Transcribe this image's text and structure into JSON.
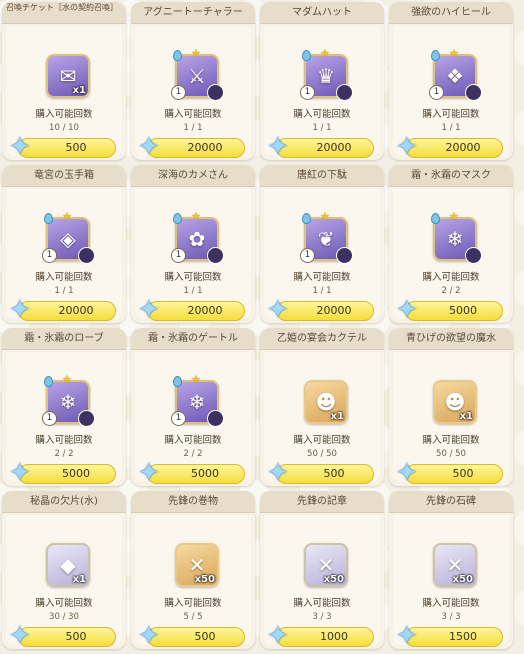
{
  "shop": {
    "items": [
      {
        "title": "召喚チケット［水の契約召喚］",
        "glyph": "✉",
        "count": "x1",
        "level": "",
        "bought": "10 / 10",
        "price": "500",
        "style": "ticket"
      },
      {
        "title": "アグニートーチャラー",
        "glyph": "⚔",
        "count": "",
        "level": "1",
        "bought": "1 / 1",
        "price": "20000",
        "style": "equip"
      },
      {
        "title": "マダムハット",
        "glyph": "♛",
        "count": "",
        "level": "1",
        "bought": "1 / 1",
        "price": "20000",
        "style": "equip"
      },
      {
        "title": "強欲のハイヒール",
        "glyph": "❖",
        "count": "",
        "level": "1",
        "bought": "1 / 1",
        "price": "20000",
        "style": "equip"
      },
      {
        "title": "竜宮の玉手箱",
        "glyph": "◈",
        "count": "",
        "level": "1",
        "bought": "1 / 1",
        "price": "20000",
        "style": "equip"
      },
      {
        "title": "深海のカメさん",
        "glyph": "✿",
        "count": "",
        "level": "1",
        "bought": "1 / 1",
        "price": "20000",
        "style": "equip"
      },
      {
        "title": "唐紅の下駄",
        "glyph": "❦",
        "count": "",
        "level": "1",
        "bought": "1 / 1",
        "price": "20000",
        "style": "equip"
      },
      {
        "title": "霜・氷霜のマスク",
        "glyph": "❄",
        "count": "",
        "level": "",
        "bought": "2 / 2",
        "price": "5000",
        "style": "equip"
      },
      {
        "title": "霜・氷霜のローブ",
        "glyph": "❄",
        "count": "",
        "level": "1",
        "bought": "2 / 2",
        "price": "5000",
        "style": "equip"
      },
      {
        "title": "霜・氷霜のゲートル",
        "glyph": "❄",
        "count": "",
        "level": "1",
        "bought": "2 / 2",
        "price": "5000",
        "style": "equip"
      },
      {
        "title": "乙姫の宴会カクテル",
        "glyph": "☻",
        "count": "x1",
        "level": "",
        "bought": "50 / 50",
        "price": "500",
        "style": "gold"
      },
      {
        "title": "青ひげの欲望の魔水",
        "glyph": "☻",
        "count": "x1",
        "level": "",
        "bought": "50 / 50",
        "price": "500",
        "style": "gold"
      },
      {
        "title": "秘晶の欠片(水)",
        "glyph": "◆",
        "count": "x1",
        "level": "",
        "bought": "30 / 30",
        "price": "500",
        "style": "pale"
      },
      {
        "title": "先鋒の巻物",
        "glyph": "✕",
        "count": "x50",
        "level": "",
        "bought": "5 / 5",
        "price": "500",
        "style": "gold"
      },
      {
        "title": "先鋒の記章",
        "glyph": "✕",
        "count": "x50",
        "level": "",
        "bought": "3 / 3",
        "price": "1000",
        "style": "pale"
      },
      {
        "title": "先鋒の石碑",
        "glyph": "✕",
        "count": "x50",
        "level": "",
        "bought": "3 / 3",
        "price": "1500",
        "style": "pale"
      }
    ],
    "label": "購入可能回数",
    "currency_icon": "gem-star-icon",
    "colors": {
      "price_bg": "#f5dd3c",
      "card_bg": "#f7f1e6"
    }
  }
}
